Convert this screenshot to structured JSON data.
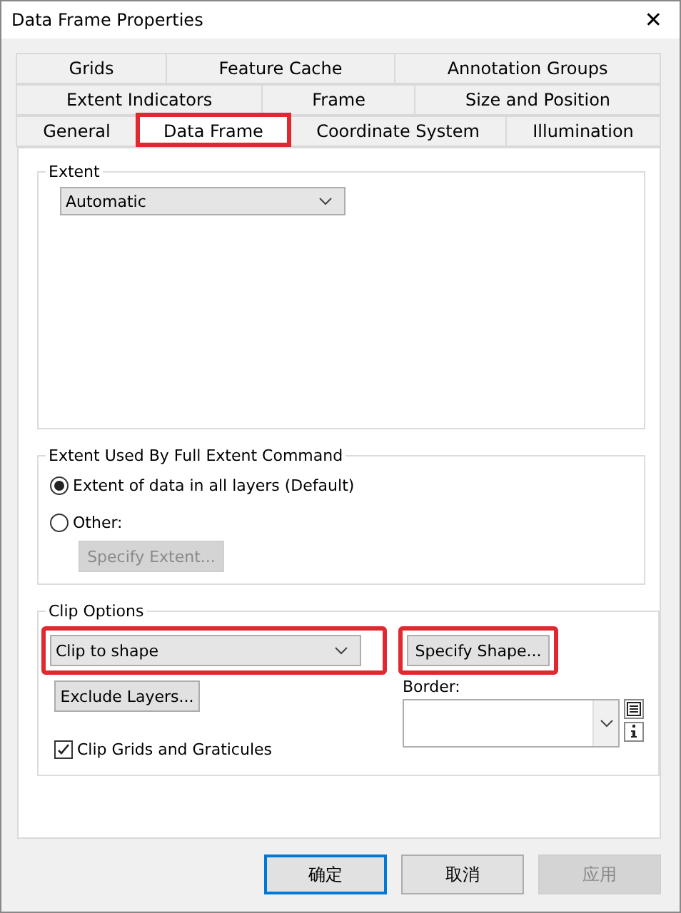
{
  "window": {
    "title": "Data Frame Properties",
    "close": "✕"
  },
  "tab_rows": [
    [
      {
        "label": "Grids",
        "selected": false
      },
      {
        "label": "Feature Cache",
        "selected": false
      },
      {
        "label": "Annotation Groups",
        "selected": false
      }
    ],
    [
      {
        "label": "Extent Indicators",
        "selected": false
      },
      {
        "label": "Frame",
        "selected": false
      },
      {
        "label": "Size and Position",
        "selected": false
      }
    ],
    [
      {
        "label": "General",
        "selected": false
      },
      {
        "label": "Data Frame",
        "selected": true,
        "highlighted": true
      },
      {
        "label": "Coordinate System",
        "selected": false
      },
      {
        "label": "Illumination",
        "selected": false
      }
    ]
  ],
  "extent": {
    "title": "Extent",
    "dropdown": "Automatic"
  },
  "full_extent": {
    "title": "Extent Used By Full Extent Command",
    "options": [
      {
        "label": "Extent of data in all layers (Default)",
        "selected": true
      },
      {
        "label": "Other:",
        "selected": false
      }
    ],
    "specify_button": {
      "label": "Specify Extent...",
      "disabled": true
    }
  },
  "clip_options": {
    "title": "Clip Options",
    "dropdown": {
      "value": "Clip to shape",
      "highlighted": true
    },
    "specify_shape_button": {
      "label": "Specify Shape...",
      "highlighted": true
    },
    "exclude_button": "Exclude Layers...",
    "border_label": "Border:",
    "clip_grids": {
      "label": "Clip Grids and Graticules",
      "checked": true
    }
  },
  "buttons": [
    {
      "label": "确定",
      "default": true,
      "disabled": false
    },
    {
      "label": "取消",
      "default": false,
      "disabled": false
    },
    {
      "label": "应用",
      "default": false,
      "disabled": true
    }
  ]
}
